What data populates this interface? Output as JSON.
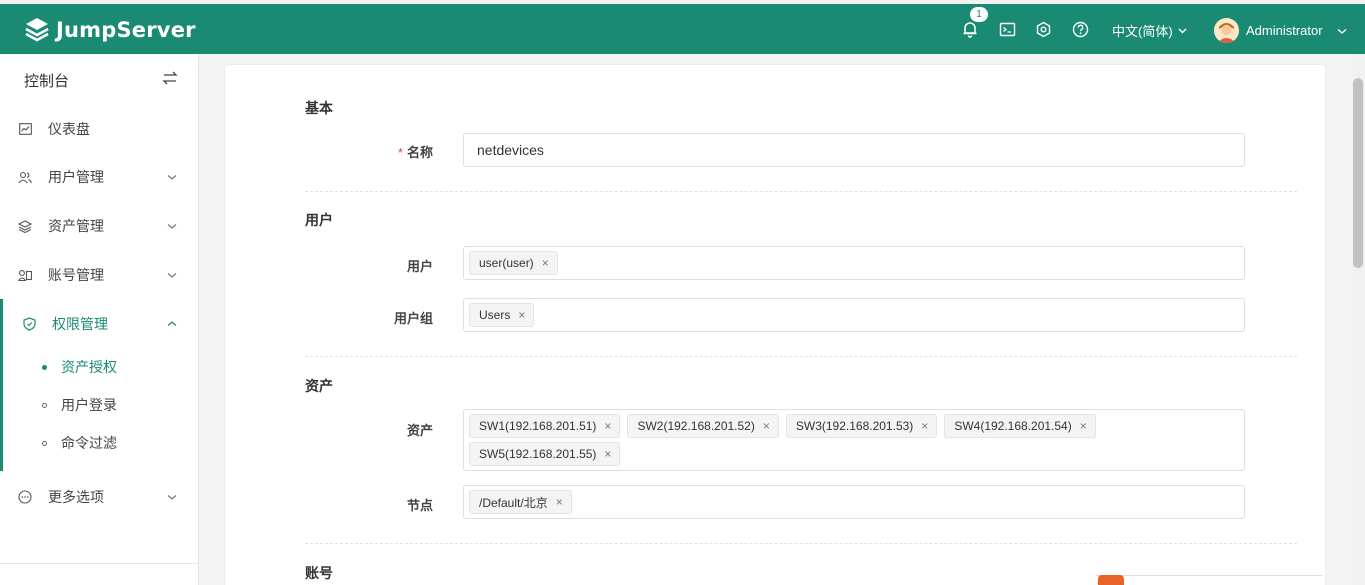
{
  "topbar": {
    "brand": "JumpServer",
    "notification_count": "1",
    "language": "中文(简体)",
    "user_name": "Administrator",
    "icons": [
      "bell-icon",
      "terminal-icon",
      "gear-icon",
      "help-icon"
    ]
  },
  "sidebar": {
    "title": "控制台",
    "items": [
      {
        "label": "仪表盘",
        "icon": "dashboard-icon"
      },
      {
        "label": "用户管理",
        "icon": "users-icon"
      },
      {
        "label": "资产管理",
        "icon": "layers-icon"
      },
      {
        "label": "账号管理",
        "icon": "account-icon"
      },
      {
        "label": "权限管理",
        "icon": "shield-icon"
      },
      {
        "label": "更多选项",
        "icon": "more-icon"
      }
    ],
    "sub_items": [
      {
        "label": "资产授权"
      },
      {
        "label": "用户登录"
      },
      {
        "label": "命令过滤"
      }
    ]
  },
  "form": {
    "sections": {
      "basic": "基本",
      "user": "用户",
      "asset": "资产",
      "account": "账号"
    },
    "name": {
      "label": "名称",
      "value": "netdevices"
    },
    "users": {
      "label": "用户",
      "tags": [
        "user(user)"
      ]
    },
    "user_groups": {
      "label": "用户组",
      "tags": [
        "Users"
      ]
    },
    "assets": {
      "label": "资产",
      "tags": [
        "SW1(192.168.201.51)",
        "SW2(192.168.201.52)",
        "SW3(192.168.201.53)",
        "SW4(192.168.201.54)",
        "SW5(192.168.201.55)"
      ]
    },
    "nodes": {
      "label": "节点",
      "tags": [
        "/Default/北京"
      ]
    },
    "tag_close": "×"
  },
  "colors": {
    "brand": "#1b8a73",
    "required": "#e64848"
  }
}
